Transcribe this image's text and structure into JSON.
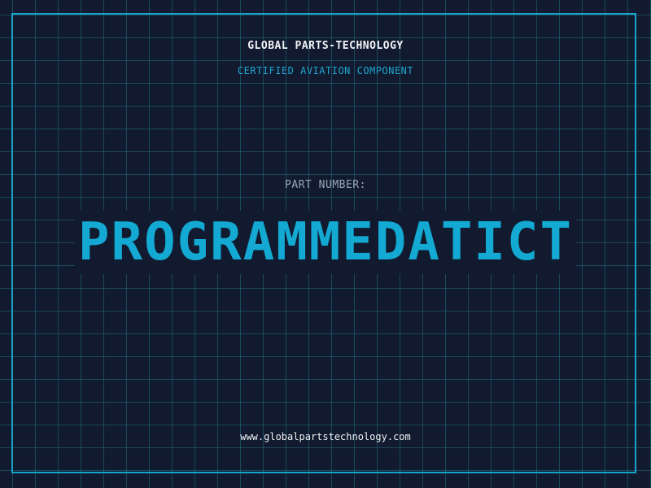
{
  "header": {
    "company": "GLOBAL PARTS-TECHNOLOGY",
    "tagline": "CERTIFIED AVIATION COMPONENT"
  },
  "part": {
    "label": "PART NUMBER:",
    "value": "PROGRAMMEDATICT"
  },
  "footer": {
    "website": "www.globalpartstechnology.com"
  },
  "colors": {
    "background": "#111a2e",
    "grid": "#216e82",
    "accent": "#13a9d3",
    "text": "#f0f3f7"
  }
}
